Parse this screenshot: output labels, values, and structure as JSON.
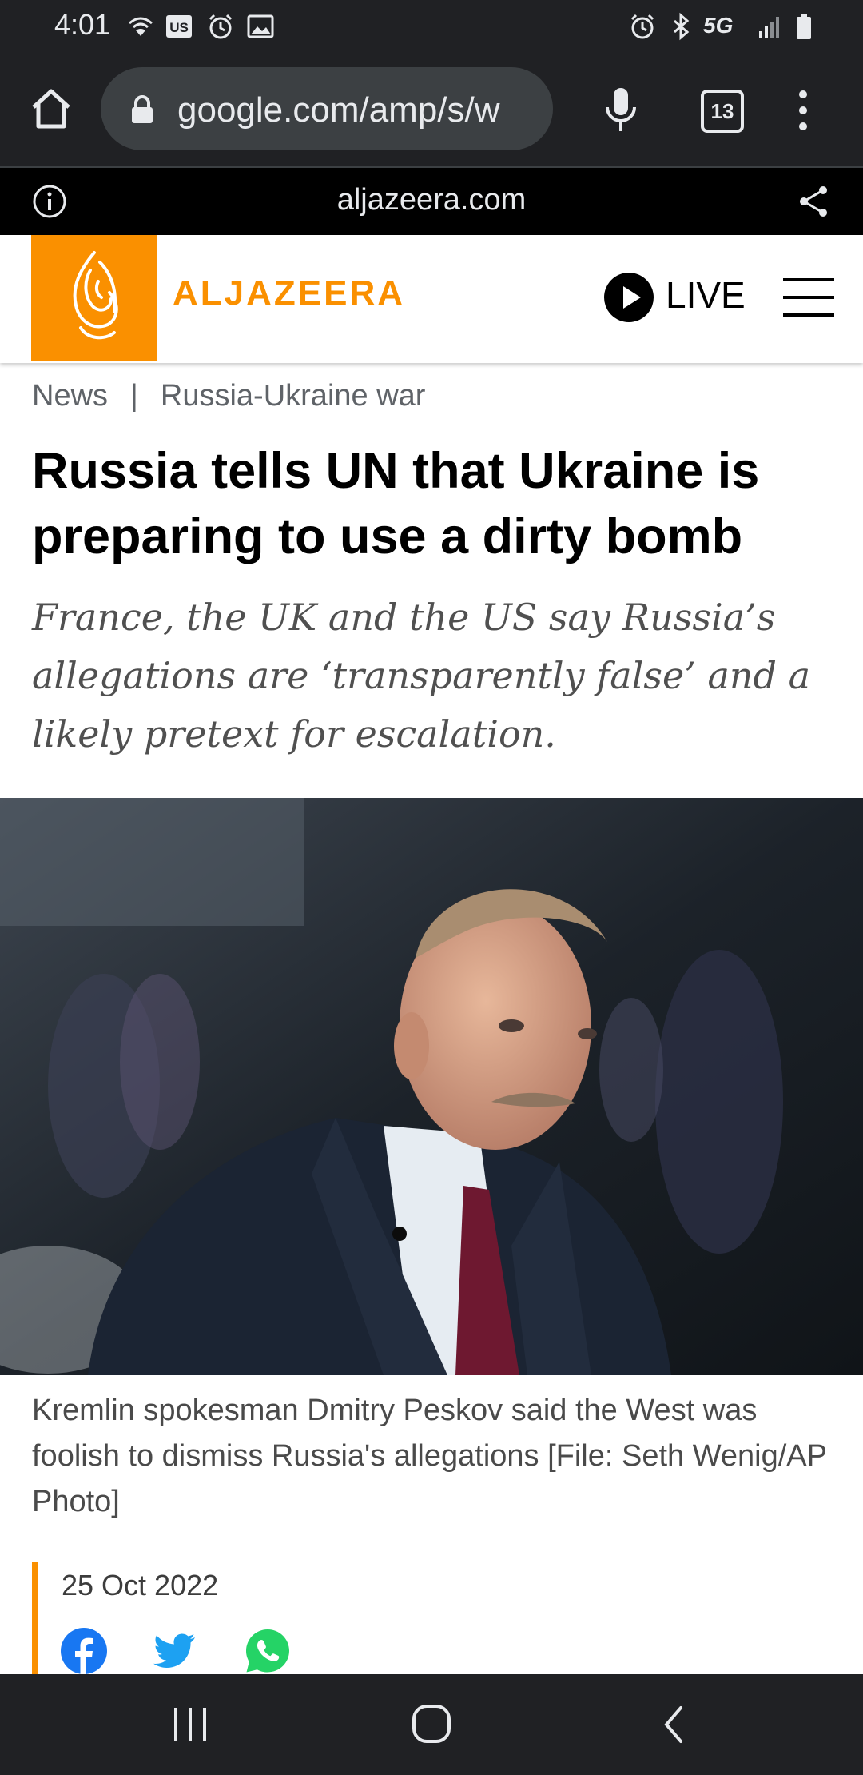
{
  "status_bar": {
    "time": "4:01",
    "left_icons": [
      "wifi-calling-icon",
      "us-app-icon",
      "alarm-icon",
      "image-icon"
    ],
    "right_icons": [
      "alarm-icon",
      "bluetooth-icon",
      "5g-icon",
      "signal-icon",
      "battery-icon"
    ],
    "network_label": "5G"
  },
  "browser": {
    "url": "google.com/amp/s/w",
    "tab_count": "13",
    "amp_domain": "aljazeera.com"
  },
  "site": {
    "brand": "ALJAZEERA",
    "live_label": "LIVE",
    "accent_color": "#fa9000"
  },
  "article": {
    "breadcrumb": {
      "section": "News",
      "separator": "|",
      "topic": "Russia-Ukraine war"
    },
    "headline": "Russia tells UN that Ukraine is preparing to use a dirty bomb",
    "dek": "France, the UK and the US say Russia’s allegations are ‘transparently false’ and a likely pretext for escalation.",
    "image_caption": "Kremlin spokesman Dmitry Peskov said the West was foolish to dismiss Russia's allegations [File: Seth Wenig/AP Photo]",
    "date": "25 Oct 2022",
    "share_icons": [
      "facebook-icon",
      "twitter-icon",
      "whatsapp-icon"
    ]
  },
  "colors": {
    "facebook": "#1877f2",
    "twitter": "#1da1f2",
    "whatsapp": "#25d366",
    "chrome_dark": "#202124"
  }
}
